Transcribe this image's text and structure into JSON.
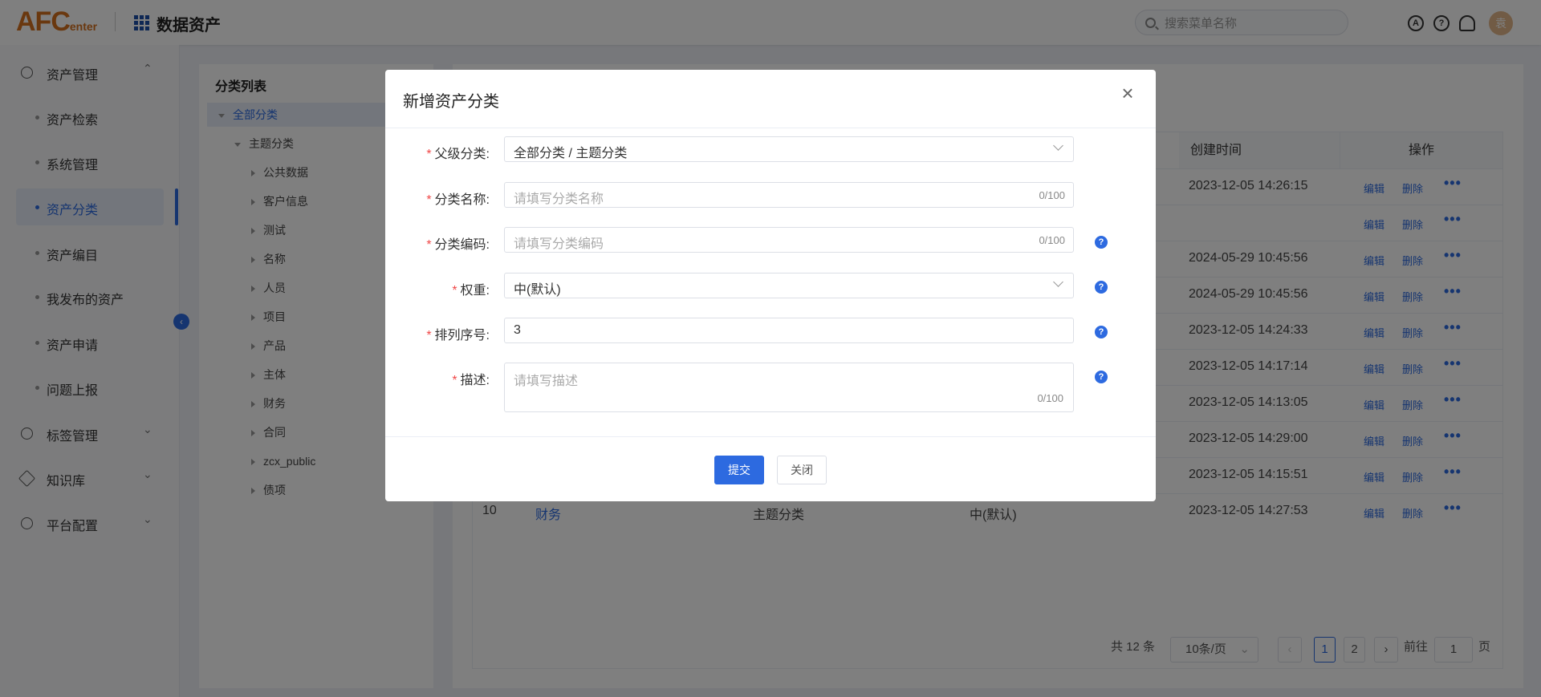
{
  "header": {
    "logo_main": "AFC",
    "logo_sub": "enter",
    "app_title": "数据资产",
    "search_placeholder": "搜索菜单名称",
    "avatar_text": "袁"
  },
  "sidebar": {
    "groups": [
      {
        "label": "资产管理",
        "chevron": "⌃"
      },
      {
        "label": "标签管理",
        "chevron": "⌄"
      },
      {
        "label": "知识库",
        "chevron": "⌄"
      },
      {
        "label": "平台配置",
        "chevron": "⌄"
      }
    ],
    "items": [
      {
        "label": "资产检索"
      },
      {
        "label": "系统管理"
      },
      {
        "label": "资产分类",
        "active": true
      },
      {
        "label": "资产编目"
      },
      {
        "label": "我发布的资产"
      },
      {
        "label": "资产申请"
      },
      {
        "label": "问题上报"
      }
    ],
    "collapse_glyph": "‹"
  },
  "tree": {
    "title": "分类列表",
    "root": "全部分类",
    "level1": "主题分类",
    "children": [
      "公共数据",
      "客户信息",
      "测试",
      "名称",
      "人员",
      "项目",
      "产品",
      "主体",
      "财务",
      "合同",
      "zcx_public",
      "债项"
    ]
  },
  "table": {
    "headers": {
      "created": "创建时间",
      "ops": "操作"
    },
    "op_edit": "编辑",
    "op_delete": "删除",
    "op_more": "•••",
    "created": [
      "2023-12-05 14:26:15",
      "",
      "2024-05-29 10:45:56",
      "2024-05-29 10:45:56",
      "2023-12-05 14:24:33",
      "2023-12-05 14:17:14",
      "2023-12-05 14:13:05",
      "2023-12-05 14:29:00",
      "2023-12-05 14:15:51",
      "2023-12-05 14:27:53"
    ],
    "last_row": {
      "index": "10",
      "name": "财务",
      "parent": "主题分类",
      "weight": "中(默认)"
    }
  },
  "pagination": {
    "total": "共 12 条",
    "page_size": "10条/页",
    "pages": [
      "1",
      "2"
    ],
    "prev": "‹",
    "next": "›",
    "goto_label": "前往",
    "goto_value": "1",
    "page_unit": "页"
  },
  "modal": {
    "title": "新增资产分类",
    "close_glyph": "×",
    "fields": {
      "parent": {
        "label": "父级分类:",
        "value": "全部分类 / 主题分类"
      },
      "name": {
        "label": "分类名称:",
        "placeholder": "请填写分类名称",
        "counter": "0/100"
      },
      "code": {
        "label": "分类编码:",
        "placeholder": "请填写分类编码",
        "counter": "0/100"
      },
      "weight": {
        "label": "权重:",
        "value": "中(默认)"
      },
      "order": {
        "label": "排列序号:",
        "value": "3"
      },
      "desc": {
        "label": "描述:",
        "placeholder": "请填写描述",
        "counter": "0/100"
      }
    },
    "required_mark": "*",
    "help_glyph": "?",
    "submit": "提交",
    "close": "关闭"
  },
  "colors": {
    "primary": "#2d6ae0",
    "logo": "#d4701e",
    "required": "#f04848"
  }
}
